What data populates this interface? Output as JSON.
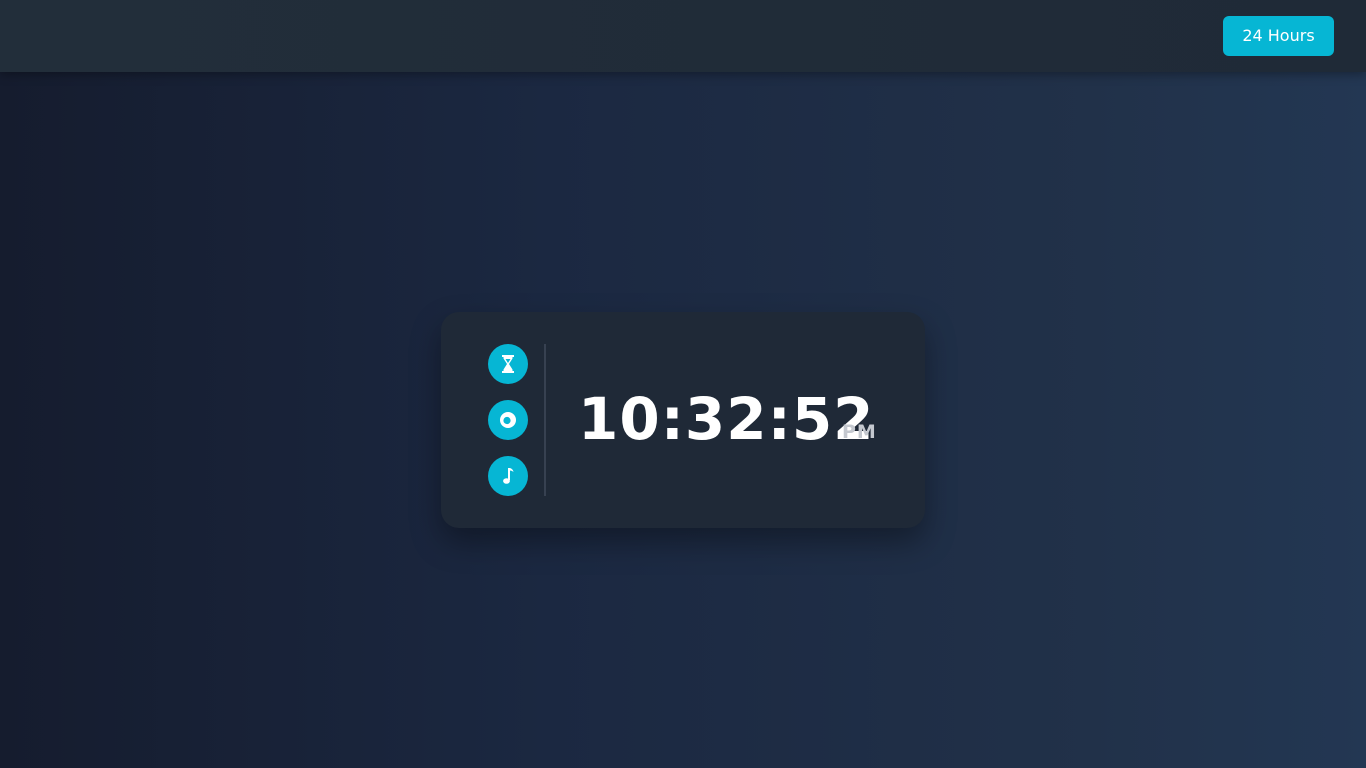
{
  "header": {
    "mode_button_label": "24 Hours"
  },
  "clock": {
    "time": "10:32:52",
    "period": "PM"
  },
  "icons": [
    "hourglass-icon",
    "disc-icon",
    "music-note-icon"
  ],
  "colors": {
    "accent": "#06b6d4",
    "card": "#1f2937",
    "topbar": "#212d39",
    "text": "#ffffff",
    "period_text": "#c4c8cf"
  }
}
